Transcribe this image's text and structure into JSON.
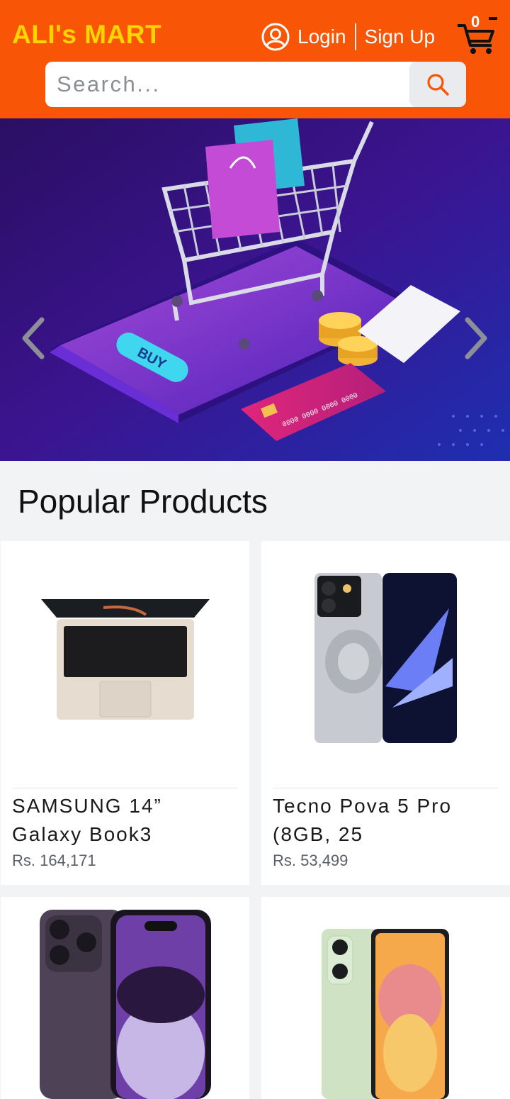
{
  "header": {
    "brand": "ALI's MART",
    "login_label": "Login",
    "signup_label": "Sign Up",
    "cart_count": "0",
    "colors": {
      "bar": "#f85606",
      "brand": "#ffd400"
    }
  },
  "search": {
    "placeholder": "Search...",
    "value": ""
  },
  "banner": {
    "buy_label": "BUY",
    "card_number": "0000 0000 0000 0000"
  },
  "popular": {
    "title": "Popular Products",
    "products": [
      {
        "name": "SAMSUNG 14” Galaxy Book3",
        "price": "Rs. 164,171"
      },
      {
        "name": "Tecno Pova 5 Pro (8GB, 25",
        "price": "Rs. 53,499"
      },
      {
        "name": "",
        "price": ""
      },
      {
        "name": "",
        "price": ""
      }
    ]
  }
}
